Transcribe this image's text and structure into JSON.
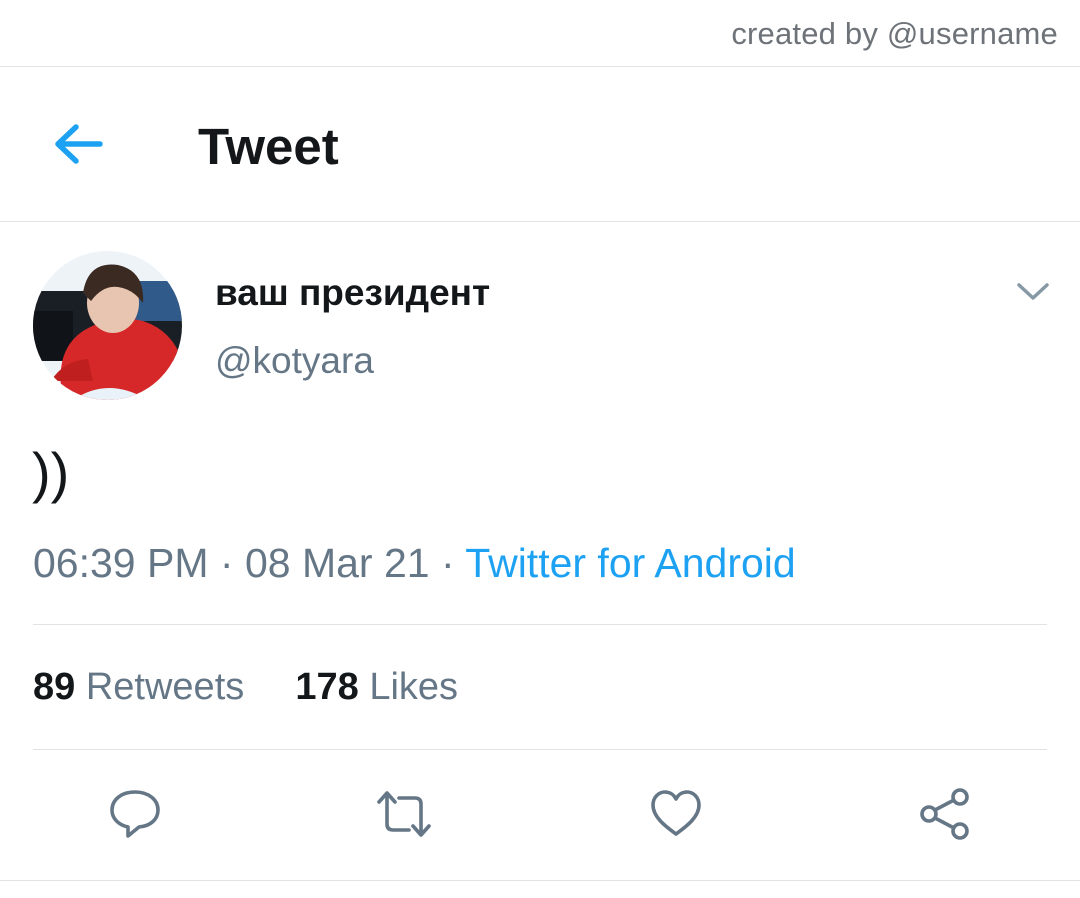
{
  "credit": "created by @username",
  "header": {
    "title": "Tweet",
    "back_icon": "arrow-left-icon"
  },
  "tweet": {
    "display_name": "ваш президент",
    "handle": "@kotyara",
    "text": "))",
    "time": "06:39 PM",
    "date": "08 Mar 21",
    "separator": "·",
    "source": "Twitter for Android",
    "retweets_count": "89",
    "retweets_label": "Retweets",
    "likes_count": "178",
    "likes_label": "Likes"
  },
  "actions": [
    {
      "name": "reply",
      "icon": "comment-icon"
    },
    {
      "name": "retweet",
      "icon": "retweet-icon"
    },
    {
      "name": "like",
      "icon": "heart-icon"
    },
    {
      "name": "share",
      "icon": "share-icon"
    }
  ],
  "colors": {
    "accent": "#1da1f2",
    "text": "#14171a",
    "secondary": "#657786",
    "icon": "#657786",
    "divider": "#e1e4e7"
  }
}
